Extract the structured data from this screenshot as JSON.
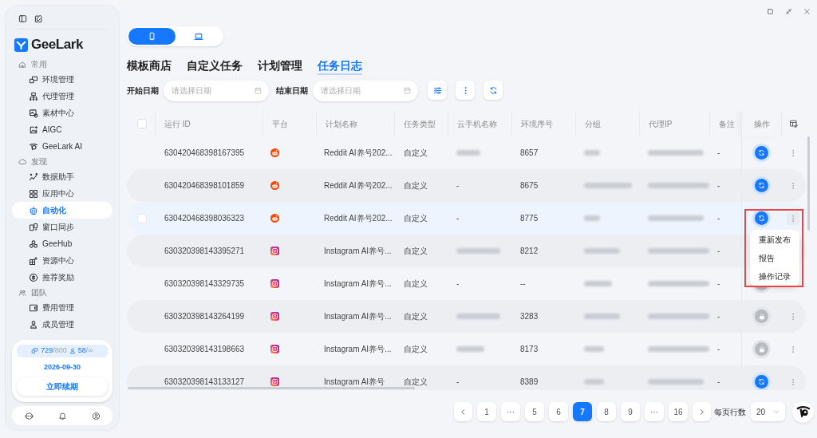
{
  "sidebar": {
    "brand": "GeeLark",
    "sections": [
      {
        "label": "常用",
        "items": [
          {
            "label": "环境管理",
            "selected": false
          },
          {
            "label": "代理管理",
            "selected": false
          },
          {
            "label": "素材中心",
            "selected": false
          },
          {
            "label": "AIGC",
            "selected": false
          },
          {
            "label": "GeeLark AI",
            "selected": false
          }
        ]
      },
      {
        "label": "发现",
        "items": [
          {
            "label": "数据助手",
            "selected": false
          },
          {
            "label": "应用中心",
            "selected": false
          },
          {
            "label": "自动化",
            "selected": true
          },
          {
            "label": "窗口同步",
            "selected": false
          },
          {
            "label": "GeeHub",
            "selected": false
          },
          {
            "label": "资源中心",
            "selected": false
          },
          {
            "label": "推荐奖励",
            "selected": false
          }
        ]
      },
      {
        "label": "团队",
        "items": [
          {
            "label": "费用管理",
            "selected": false
          },
          {
            "label": "成员管理",
            "selected": false
          }
        ]
      }
    ],
    "quota": {
      "profiles_used": "729",
      "profiles_total": "/800",
      "members_used": "58",
      "members_total": "/∞"
    },
    "expiry": "2026-09-30",
    "renew_button": "立即续期"
  },
  "device_toggle": [
    {
      "kind": "phone",
      "selected": true
    },
    {
      "kind": "laptop",
      "selected": false
    }
  ],
  "tabs": [
    {
      "label": "模板商店",
      "selected": false
    },
    {
      "label": "自定义任务",
      "selected": false
    },
    {
      "label": "计划管理",
      "selected": false
    },
    {
      "label": "任务日志",
      "selected": true
    }
  ],
  "filters": [
    {
      "label": "开始日期",
      "placeholder": "请选择日期"
    },
    {
      "label": "结束日期",
      "placeholder": "请选择日期"
    }
  ],
  "table": {
    "select_all": {
      "checked": false
    },
    "columns": [
      "运行 ID",
      "平台",
      "计划名称",
      "任务类型",
      "云手机名称",
      "环境序号",
      "分组",
      "代理IP",
      "备注",
      "操作"
    ],
    "rows": [
      {
        "run_id": "630420468398167395",
        "platform": {
          "kind": "reddit"
        },
        "plan_name": "Reddit AI养号202...",
        "task_type": "自定义",
        "phone_name": {
          "blurred": true
        },
        "env_no": "8657",
        "remark": "-",
        "action": {
          "kind": "sync"
        },
        "more": {
          "kind": "closed"
        },
        "hovered": false
      },
      {
        "run_id": "630420468398101859",
        "platform": {
          "kind": "reddit"
        },
        "plan_name": "Reddit AI养号202...",
        "task_type": "自定义",
        "phone_name": {
          "text": "-"
        },
        "env_no": "8675",
        "remark": "-",
        "action": {
          "kind": "sync"
        },
        "more": {
          "kind": "closed"
        },
        "hovered": false
      },
      {
        "run_id": "630420468398036323",
        "platform": {
          "kind": "reddit"
        },
        "plan_name": "Reddit AI养号202...",
        "task_type": "自定义",
        "phone_name": {
          "text": "-"
        },
        "env_no": "8775",
        "remark": "-",
        "action": {
          "kind": "sync"
        },
        "more": {
          "kind": "open"
        },
        "hovered": true
      },
      {
        "run_id": "630320398143395271",
        "platform": {
          "kind": "instagram"
        },
        "plan_name": "Instagram AI养号...",
        "task_type": "自定义",
        "phone_name": {
          "blurred": true
        },
        "env_no": "8212",
        "remark": "-",
        "hovered": false
      },
      {
        "run_id": "630320398143329735",
        "platform": {
          "kind": "instagram"
        },
        "plan_name": "Instagram AI养号...",
        "task_type": "自定义",
        "phone_name": {
          "text": "-"
        },
        "env_no": "--",
        "remark": "-",
        "action": {
          "kind": "grey"
        },
        "hovered": false
      },
      {
        "run_id": "630320398143264199",
        "platform": {
          "kind": "instagram"
        },
        "plan_name": "Instagram AI养号...",
        "task_type": "自定义",
        "phone_name": {
          "blurred": true
        },
        "env_no": "3283",
        "remark": "-",
        "action": {
          "kind": "locked"
        },
        "more": {
          "kind": "closed"
        },
        "hovered": false
      },
      {
        "run_id": "630320398143198663",
        "platform": {
          "kind": "instagram"
        },
        "plan_name": "Instagram AI养号...",
        "task_type": "自定义",
        "phone_name": {
          "blurred": true
        },
        "env_no": "8173",
        "remark": "-",
        "action": {
          "kind": "locked"
        },
        "more": {
          "kind": "closed"
        },
        "hovered": false
      },
      {
        "run_id": "630320398143133127",
        "platform": {
          "kind": "instagram"
        },
        "plan_name": "Instagram AI养号",
        "task_type": "自定义",
        "phone_name": {
          "text": "-"
        },
        "env_no": "8389",
        "remark": "-",
        "action": {
          "kind": "sync"
        },
        "more": {
          "kind": "closed"
        },
        "hovered": false
      }
    ]
  },
  "row_menu": {
    "outlined": true,
    "items": [
      "重新发布",
      "报告",
      "操作记录"
    ]
  },
  "pagination": {
    "pages": [
      {
        "label": "1",
        "selected": false
      },
      {
        "label": "···",
        "selected": false
      },
      {
        "label": "5",
        "selected": false
      },
      {
        "label": "6",
        "selected": false
      },
      {
        "label": "7",
        "selected": true
      },
      {
        "label": "8",
        "selected": false
      },
      {
        "label": "9",
        "selected": false
      },
      {
        "label": "···",
        "selected": false
      },
      {
        "label": "16",
        "selected": false
      }
    ],
    "page_size_label": "每页行数",
    "page_size": "20"
  }
}
